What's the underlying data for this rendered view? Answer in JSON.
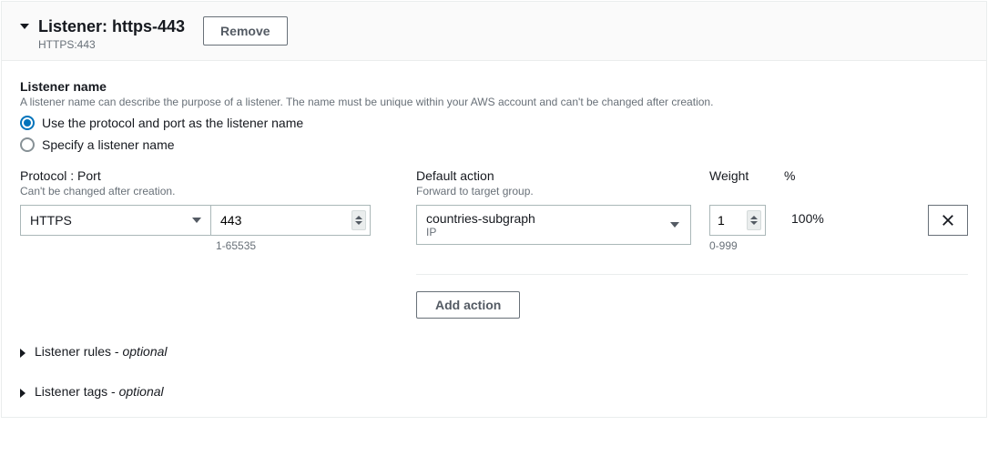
{
  "header": {
    "title": "Listener: https-443",
    "subtitle": "HTTPS:443",
    "remove_label": "Remove"
  },
  "listener_name": {
    "label": "Listener name",
    "help": "A listener name can describe the purpose of a listener. The name must be unique within your AWS account and can't be changed after creation.",
    "option_auto": "Use the protocol and port as the listener name",
    "option_manual": "Specify a listener name"
  },
  "protocol_port": {
    "label": "Protocol : Port",
    "help": "Can't be changed after creation.",
    "protocol_value": "HTTPS",
    "port_value": "443",
    "port_range": "1-65535"
  },
  "default_action": {
    "label": "Default action",
    "help": "Forward to target group.",
    "weight_label": "Weight",
    "pct_label": "%",
    "target_name": "countries-subgraph",
    "target_type": "IP",
    "weight_value": "1",
    "weight_range": "0-999",
    "pct_value": "100%",
    "add_action_label": "Add action"
  },
  "expandables": {
    "rules_label": "Listener rules - ",
    "rules_optional": "optional",
    "tags_label": "Listener tags - ",
    "tags_optional": "optional"
  }
}
